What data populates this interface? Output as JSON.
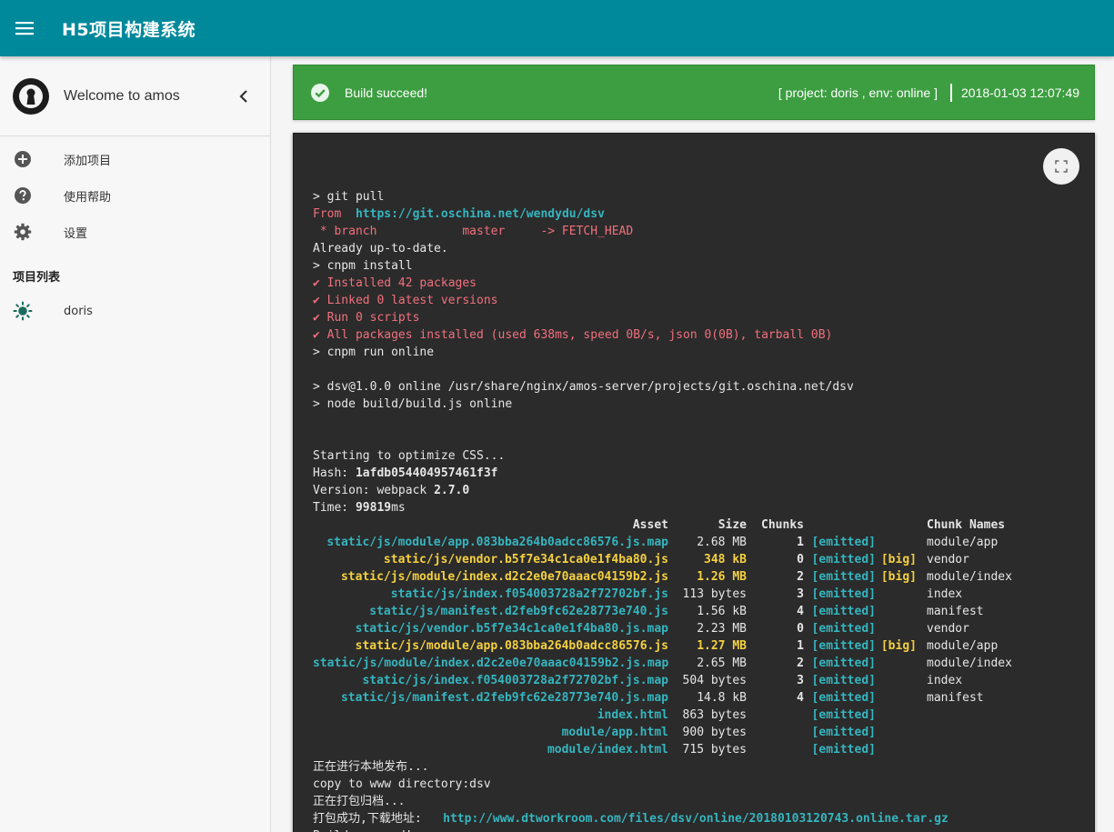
{
  "app": {
    "title": "H5项目构建系统"
  },
  "sidebar": {
    "welcome": "Welcome to amos",
    "nav": [
      {
        "icon": "add-circle-icon",
        "label": "添加项目"
      },
      {
        "icon": "help-icon",
        "label": "使用帮助"
      },
      {
        "icon": "gear-icon",
        "label": "设置"
      }
    ],
    "projects_title": "项目列表",
    "projects": [
      {
        "icon": "sun-icon",
        "label": "doris"
      }
    ]
  },
  "banner": {
    "message": "Build succeed!",
    "project_info": "[ project: doris , env: online ]",
    "timestamp": "2018-01-03 12:07:49"
  },
  "console": {
    "lines_top": [
      {
        "text": "",
        "color": "white"
      },
      {
        "text": "> git pull",
        "color": "white"
      },
      {
        "parts": [
          {
            "text": "From  ",
            "color": "red"
          },
          {
            "text": "https://git.oschina.net/wendydu/dsv",
            "color": "cyan"
          }
        ]
      },
      {
        "text": " * branch            master     -> FETCH_HEAD",
        "color": "red"
      },
      {
        "text": "Already up-to-date.",
        "color": "white"
      },
      {
        "text": "> cnpm install",
        "color": "white"
      },
      {
        "text": "✔ Installed 42 packages",
        "color": "red"
      },
      {
        "text": "✔ Linked 0 latest versions",
        "color": "red"
      },
      {
        "text": "✔ Run 0 scripts",
        "color": "red"
      },
      {
        "text": "✔ All packages installed (used 638ms, speed 0B/s, json 0(0B), tarball 0B)",
        "color": "red"
      },
      {
        "text": "> cnpm run online",
        "color": "white"
      },
      {
        "text": "",
        "color": "white"
      },
      {
        "text": "> dsv@1.0.0 online /usr/share/nginx/amos-server/projects/git.oschina.net/dsv",
        "color": "white"
      },
      {
        "text": "> node build/build.js online",
        "color": "white"
      },
      {
        "text": "",
        "color": "white"
      },
      {
        "text": "",
        "color": "white"
      },
      {
        "text": "Starting to optimize CSS...",
        "color": "white"
      },
      {
        "parts": [
          {
            "text": "Hash: ",
            "color": "white"
          },
          {
            "text": "1afdb054404957461f3f",
            "color": "bold"
          }
        ]
      },
      {
        "parts": [
          {
            "text": "Version: webpack ",
            "color": "white"
          },
          {
            "text": "2.7.0",
            "color": "bold"
          }
        ]
      },
      {
        "parts": [
          {
            "text": "Time: ",
            "color": "white"
          },
          {
            "text": "99819",
            "color": "bold"
          },
          {
            "text": "ms",
            "color": "white"
          }
        ]
      }
    ],
    "asset_header": {
      "asset": "Asset",
      "size": "Size",
      "chunks": "Chunks",
      "names": "Chunk Names"
    },
    "assets": [
      {
        "asset": "static/js/module/app.083bba264b0adcc86576.js.map",
        "size": "2.68 MB",
        "chunks": "1",
        "emitted": "[emitted]",
        "big": "",
        "names": "module/app",
        "highlight": false
      },
      {
        "asset": "static/js/vendor.b5f7e34c1ca0e1f4ba80.js",
        "size": "348 kB",
        "chunks": "0",
        "emitted": "[emitted]",
        "big": "[big]",
        "names": "vendor",
        "highlight": true
      },
      {
        "asset": "static/js/module/index.d2c2e0e70aaac04159b2.js",
        "size": "1.26 MB",
        "chunks": "2",
        "emitted": "[emitted]",
        "big": "[big]",
        "names": "module/index",
        "highlight": true
      },
      {
        "asset": "static/js/index.f054003728a2f72702bf.js",
        "size": "113 bytes",
        "chunks": "3",
        "emitted": "[emitted]",
        "big": "",
        "names": "index",
        "highlight": false
      },
      {
        "asset": "static/js/manifest.d2feb9fc62e28773e740.js",
        "size": "1.56 kB",
        "chunks": "4",
        "emitted": "[emitted]",
        "big": "",
        "names": "manifest",
        "highlight": false
      },
      {
        "asset": "static/js/vendor.b5f7e34c1ca0e1f4ba80.js.map",
        "size": "2.23 MB",
        "chunks": "0",
        "emitted": "[emitted]",
        "big": "",
        "names": "vendor",
        "highlight": false
      },
      {
        "asset": "static/js/module/app.083bba264b0adcc86576.js",
        "size": "1.27 MB",
        "chunks": "1",
        "emitted": "[emitted]",
        "big": "[big]",
        "names": "module/app",
        "highlight": true
      },
      {
        "asset": "static/js/module/index.d2c2e0e70aaac04159b2.js.map",
        "size": "2.65 MB",
        "chunks": "2",
        "emitted": "[emitted]",
        "big": "",
        "names": "module/index",
        "highlight": false
      },
      {
        "asset": "static/js/index.f054003728a2f72702bf.js.map",
        "size": "504 bytes",
        "chunks": "3",
        "emitted": "[emitted]",
        "big": "",
        "names": "index",
        "highlight": false
      },
      {
        "asset": "static/js/manifest.d2feb9fc62e28773e740.js.map",
        "size": "14.8 kB",
        "chunks": "4",
        "emitted": "[emitted]",
        "big": "",
        "names": "manifest",
        "highlight": false
      },
      {
        "asset": "index.html",
        "size": "863 bytes",
        "chunks": "",
        "emitted": "[emitted]",
        "big": "",
        "names": "",
        "highlight": false
      },
      {
        "asset": "module/app.html",
        "size": "900 bytes",
        "chunks": "",
        "emitted": "[emitted]",
        "big": "",
        "names": "",
        "highlight": false
      },
      {
        "asset": "module/index.html",
        "size": "715 bytes",
        "chunks": "",
        "emitted": "[emitted]",
        "big": "",
        "names": "",
        "highlight": false
      }
    ],
    "lines_bottom": [
      {
        "text": "正在进行本地发布...",
        "color": "white"
      },
      {
        "text": "copy to www directory:dsv",
        "color": "white"
      },
      {
        "text": "正在打包归档...",
        "color": "white"
      },
      {
        "parts": [
          {
            "text": "打包成功,下载地址:   ",
            "color": "white"
          },
          {
            "text": "http://www.dtworkroom.com/files/dsv/online/20180103120743.online.tar.gz",
            "color": "cyan"
          }
        ]
      },
      {
        "text": "Build succeed!",
        "color": "white"
      }
    ]
  },
  "colors": {
    "appbar": "#00899b",
    "banner": "#3d9e41",
    "console_bg": "#2b2b2b",
    "red": "#f0707d",
    "cyan": "#35b5bf",
    "yellow": "#f4d03f"
  }
}
